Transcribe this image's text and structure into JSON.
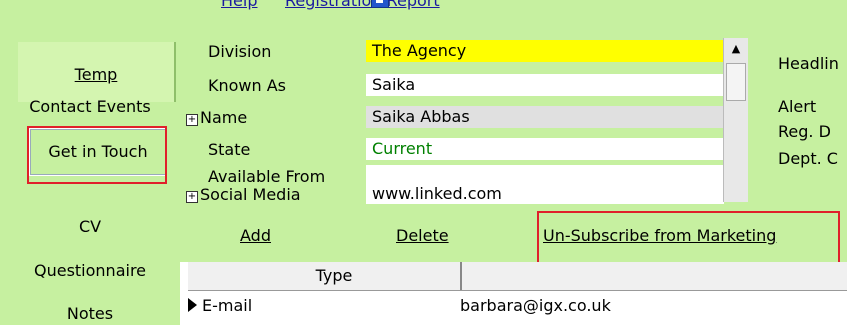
{
  "toplinks": [
    "Help",
    "Registration Report"
  ],
  "sidebar": {
    "items": [
      "Temp",
      "Contact Events",
      "Get in Touch",
      "CV",
      "Questionnaire",
      "Notes"
    ]
  },
  "fields": [
    {
      "label": "Division",
      "value": "The Agency"
    },
    {
      "label": "Known As",
      "value": "Saika"
    },
    {
      "label": "Name",
      "value": "Saika Abbas"
    },
    {
      "label": "State",
      "value": "Current"
    },
    {
      "label": "Available From",
      "value": ""
    },
    {
      "label": "Social Media",
      "value": "www.linked.com"
    }
  ],
  "right_labels": [
    "Headlin",
    "Alert",
    "Reg. D",
    "Dept. C"
  ],
  "actions": [
    "Add",
    "Delete",
    "Un-Subscribe from Marketing"
  ],
  "grid": {
    "column": "Type",
    "rows": [
      {
        "type": "E-mail",
        "value": "barbara@igx.co.uk"
      }
    ]
  },
  "colors": {
    "background": "#c6f0a0",
    "highlight": "#ffff00",
    "current_text": "#008000",
    "callout": "#e0202a"
  }
}
